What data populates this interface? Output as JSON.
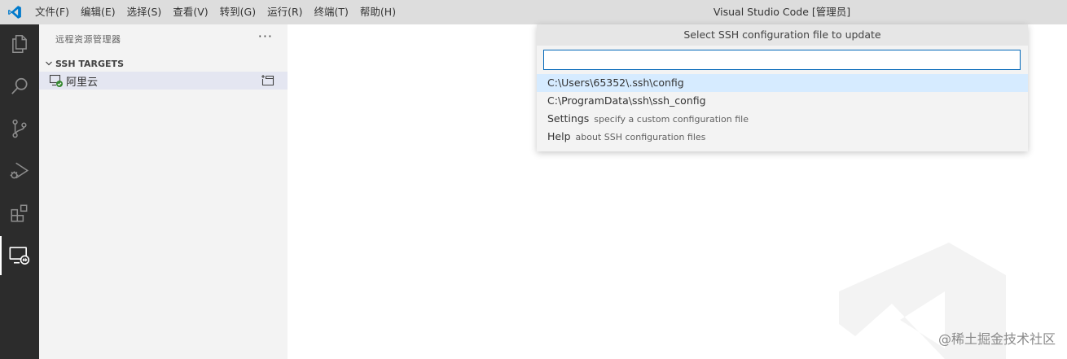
{
  "titlebar": {
    "menu": [
      {
        "label": "文件(F)"
      },
      {
        "label": "编辑(E)"
      },
      {
        "label": "选择(S)"
      },
      {
        "label": "查看(V)"
      },
      {
        "label": "转到(G)"
      },
      {
        "label": "运行(R)"
      },
      {
        "label": "终端(T)"
      },
      {
        "label": "帮助(H)"
      }
    ],
    "window_title": "Visual Studio Code [管理员]"
  },
  "activitybar": {
    "items": [
      {
        "icon": "files-icon"
      },
      {
        "icon": "search-icon"
      },
      {
        "icon": "source-control-icon"
      },
      {
        "icon": "run-debug-icon"
      },
      {
        "icon": "extensions-icon"
      },
      {
        "icon": "remote-explorer-icon",
        "active": true
      }
    ]
  },
  "sidebar": {
    "title": "远程资源管理器",
    "more": "···",
    "section": "SSH TARGETS",
    "targets": [
      {
        "label": "阿里云",
        "icon": "remote-host-connected-icon",
        "action_icon": "new-window-icon"
      }
    ]
  },
  "quickpick": {
    "title": "Select SSH configuration file to update",
    "input_value": "",
    "items": [
      {
        "label": "C:\\Users\\65352\\.ssh\\config",
        "description": "",
        "selected": true
      },
      {
        "label": "C:\\ProgramData\\ssh\\ssh_config",
        "description": ""
      },
      {
        "label": "Settings",
        "description": "specify a custom configuration file"
      },
      {
        "label": "Help",
        "description": "about SSH configuration files"
      }
    ]
  },
  "watermark": {
    "text": "@稀土掘金技术社区"
  },
  "colors": {
    "accent": "#0066b8",
    "activitybar": "#2c2c2c",
    "sidebar": "#f3f3f3",
    "selection": "#d6ebff",
    "connected": "#388a34"
  }
}
